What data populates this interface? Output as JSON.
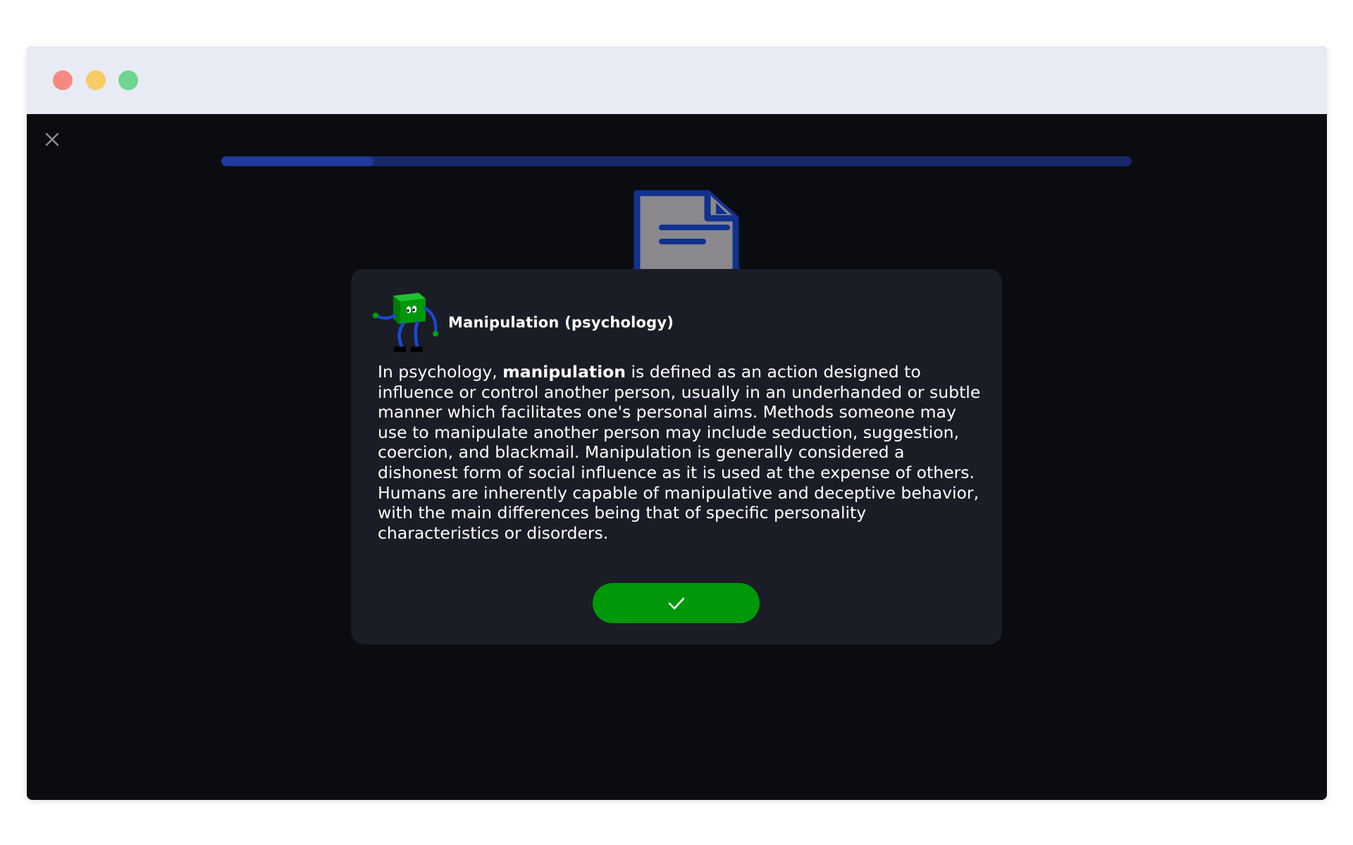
{
  "window": {
    "controls": [
      "close-dot",
      "minimize-dot",
      "maximize-dot"
    ]
  },
  "lesson": {
    "close_icon": "x-icon",
    "progress": {
      "value": 0.167
    },
    "header_icon": "document-icon"
  },
  "card": {
    "mascot_icon": "green-cube-mascot",
    "title": "Manipulation (psychology)",
    "text_before": "In psychology, ",
    "text_bold": "manipulation",
    "text_after": " is defined as an action designed to influence or control another person, usually in an underhanded or subtle manner which facilitates one's personal aims. Methods someone may use to manipulate another person may include seduction, suggestion, coercion, and blackmail. Manipulation is generally considered a dishonest form of social influence as it is used at the expense of others. Humans are inherently capable of manipulative and deceptive behavior, with the main differences being that of specific personality characteristics or disorders.",
    "confirm_icon": "checkmark-icon"
  },
  "colors": {
    "background": "#0b0c10",
    "card": "#1b1d26",
    "accent_green": "#00980b",
    "progress_track": "#17286b",
    "progress_fill": "#1f3a9c"
  }
}
